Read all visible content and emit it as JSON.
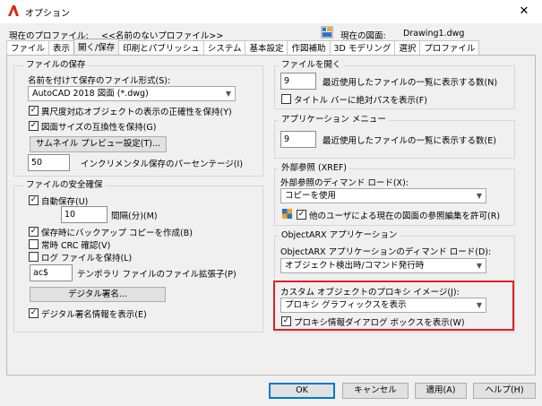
{
  "window": {
    "title": "オプション",
    "close_glyph": "✕"
  },
  "header": {
    "profile_label": "現在のプロファイル:",
    "profile_value": "<<名前のないプロファイル>>",
    "drawing_label": "現在の図面:",
    "drawing_value": "Drawing1.dwg"
  },
  "tabs": [
    "ファイル",
    "表示",
    "開く/保存",
    "印刷とパブリッシュ",
    "システム",
    "基本設定",
    "作図補助",
    "3D モデリング",
    "選択",
    "プロファイル"
  ],
  "left": {
    "save": {
      "title": "ファイルの保存",
      "format_label": "名前を付けて保存のファイル形式(S):",
      "format_value": "AutoCAD 2018 図面 (*.dwg)",
      "maintain_visual": "異尺度対応オブジェクトの表示の正確性を保持(Y)",
      "maintain_size": "図面サイズの互換性を保持(G)",
      "thumbnail_button": "サムネイル プレビュー設定(T)...",
      "incremental_value": "50",
      "incremental_label": "インクリメンタル保存のパーセンテージ(I)"
    },
    "safety": {
      "title": "ファイルの安全確保",
      "autosave": "自動保存(U)",
      "interval_value": "10",
      "interval_label": "間隔(分)(M)",
      "backup": "保存時にバックアップ コピーを作成(B)",
      "crc": "常時 CRC 確認(V)",
      "log": "ログ ファイルを保持(L)",
      "ext_value": "ac$",
      "ext_label": "テンポラリ ファイルのファイル拡張子(P)",
      "signature_button": "デジタル署名...",
      "signature_info": "デジタル署名情報を表示(E)"
    }
  },
  "right": {
    "open": {
      "title": "ファイルを開く",
      "recent_value": "9",
      "recent_label": "最近使用したファイルの一覧に表示する数(N)",
      "fullpath": "タイトル バーに絶対パスを表示(F)"
    },
    "appmenu": {
      "title": "アプリケーション メニュー",
      "recent_value": "9",
      "recent_label": "最近使用したファイルの一覧に表示する数(E)"
    },
    "xref": {
      "title": "外部参照 (XREF)",
      "demand_label": "外部参照のディマンド ロード(X):",
      "demand_value": "コピーを使用",
      "allow_edit": "他のユーザによる現在の図面の参照編集を許可(R)"
    },
    "objectarx": {
      "title": "ObjectARX アプリケーション",
      "demand_label": "ObjectARX アプリケーションのディマンド ロード(D):",
      "demand_value": "オブジェクト検出時/コマンド発行時",
      "proxy_label": "カスタム オブジェクトのプロキシ イメージ(J):",
      "proxy_value": "プロキシ グラフィックスを表示",
      "proxy_dialog": "プロキシ情報ダイアログ ボックスを表示(W)"
    }
  },
  "buttons": {
    "ok": "OK",
    "cancel": "キャンセル",
    "apply": "適用(A)",
    "help": "ヘルプ(H)"
  },
  "check_glyph": "✓",
  "colors": {
    "highlight": "#e02020",
    "default_button": "#0078d7",
    "app_icon": "#d9261c"
  }
}
